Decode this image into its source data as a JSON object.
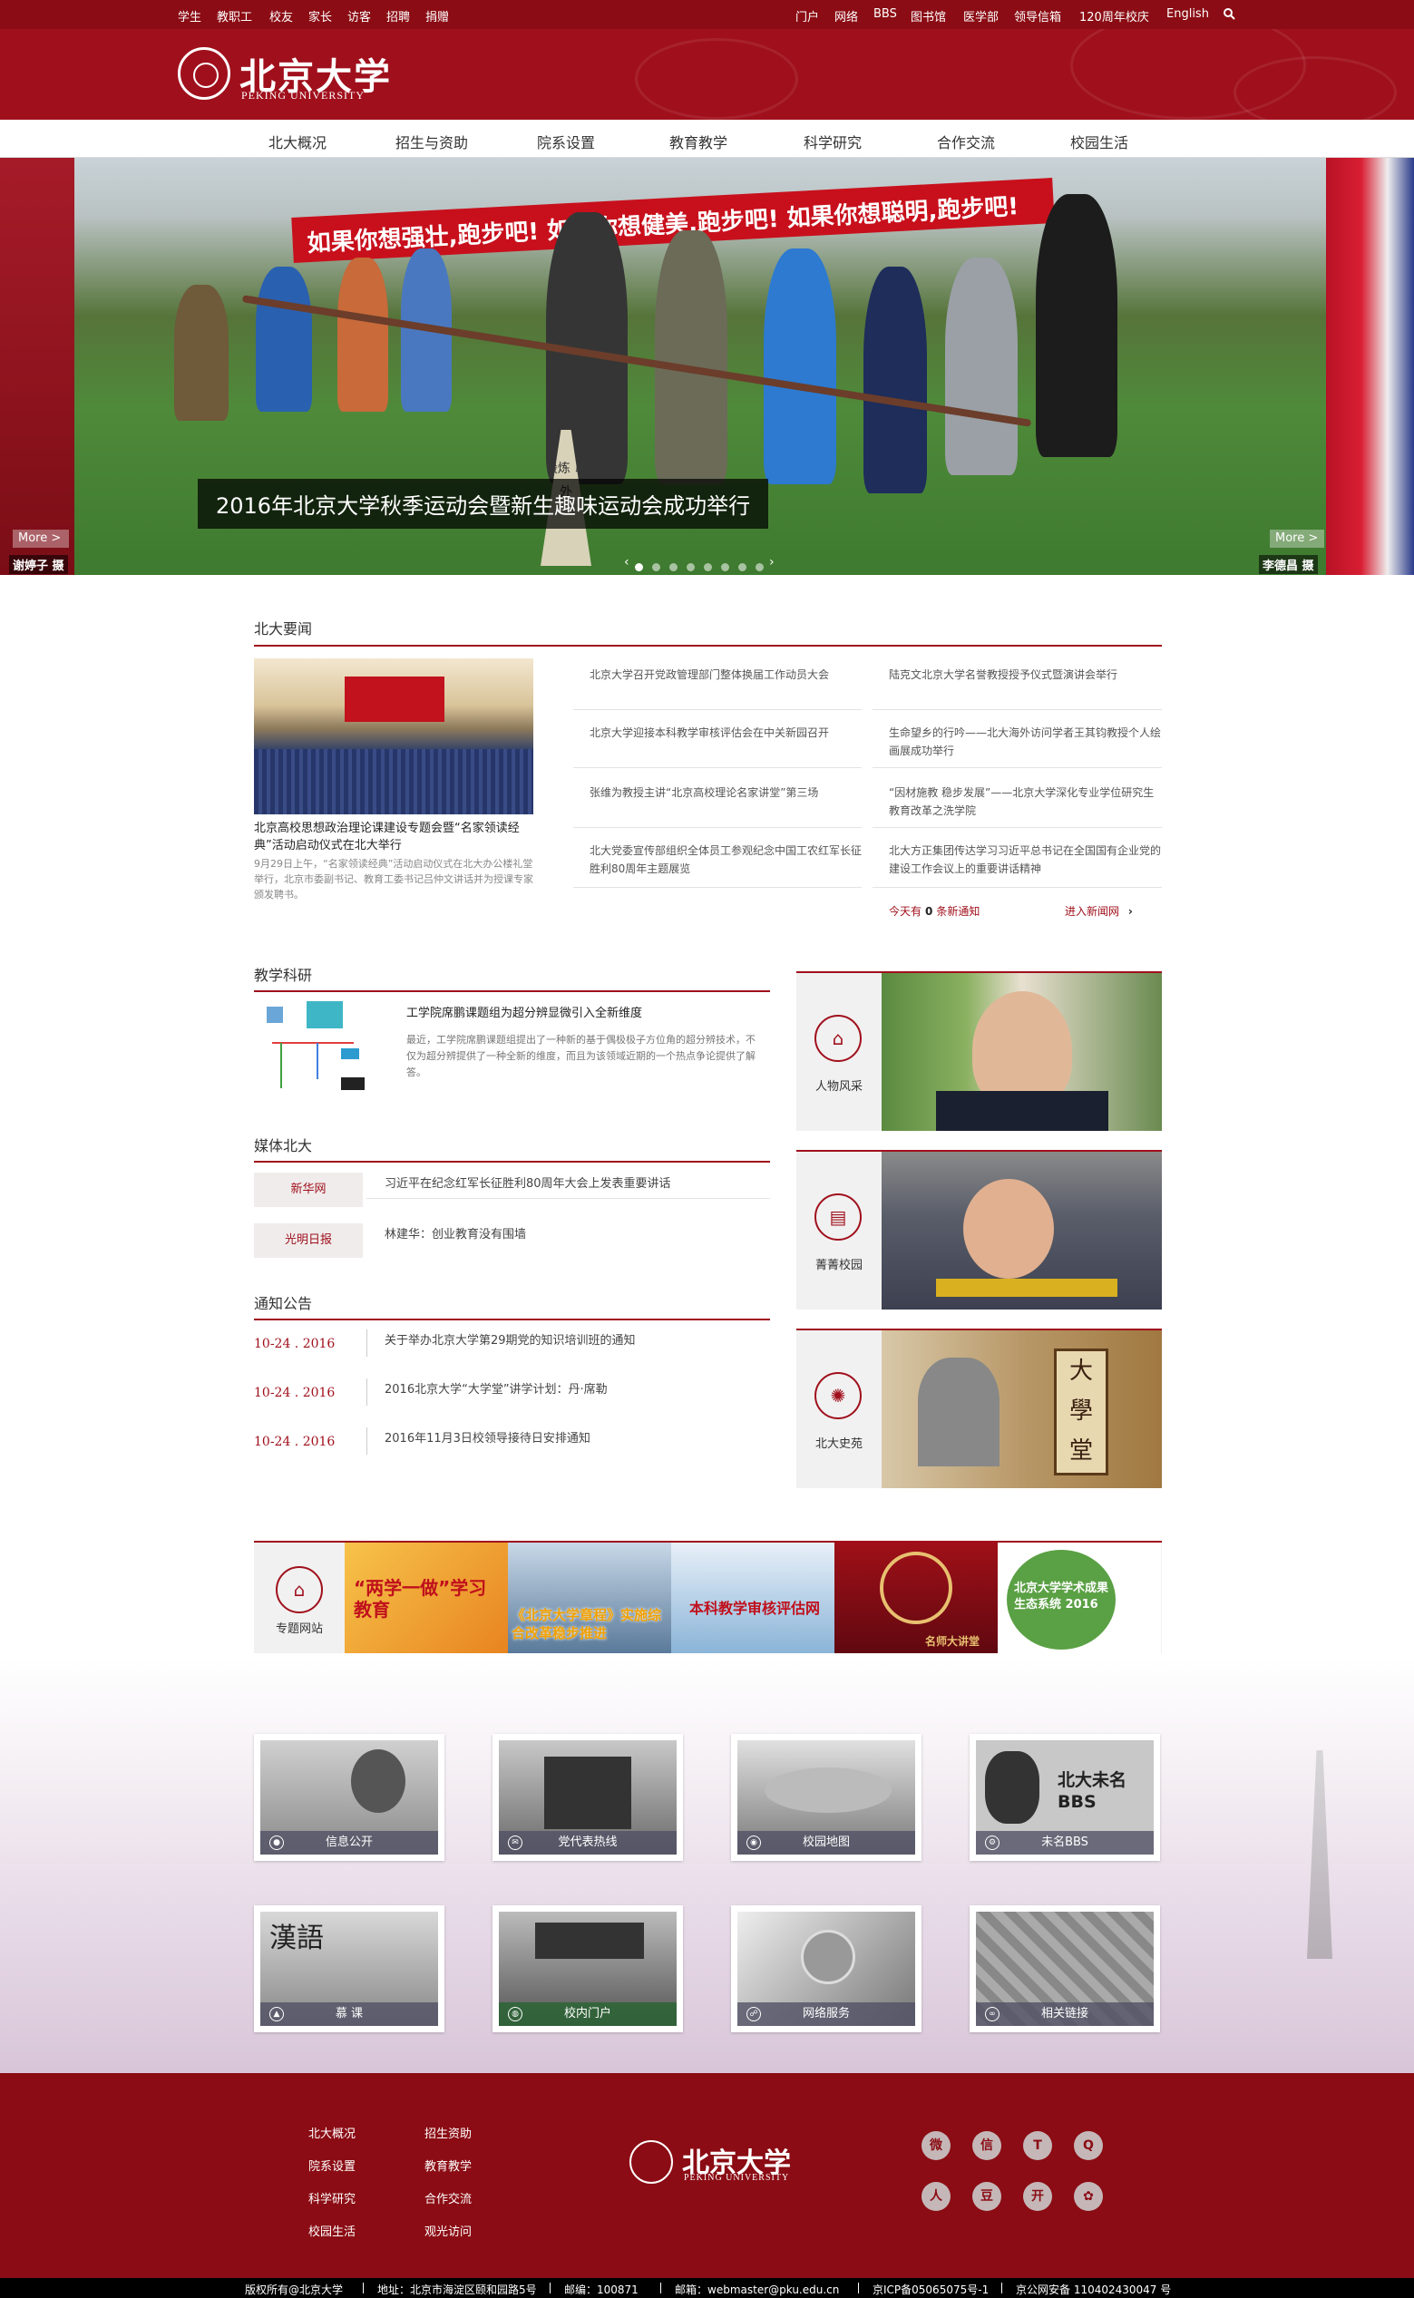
{
  "topbar": {
    "left_links": [
      "学生",
      "教职工",
      "校友",
      "家长",
      "访客",
      "招聘",
      "捐赠"
    ],
    "right_links": [
      "门户",
      "网络",
      "BBS",
      "图书馆",
      "医学部",
      "领导信箱",
      "120周年校庆",
      "English"
    ],
    "search_icon": "search-icon"
  },
  "header": {
    "logo_cn": "北京大学",
    "logo_en": "PEKING UNIVERSITY"
  },
  "nav": {
    "items": [
      "北大概况",
      "招生与资助",
      "院系设置",
      "教育教学",
      "科学研究",
      "合作交流",
      "校园生活"
    ]
  },
  "hero": {
    "banner_text": "如果你想强壮,跑步吧! 如果你想健美,跑步吧! 如果你想聪明,跑步吧!",
    "cone_text": "锻炼 以外",
    "caption": "2016年北京大学秋季运动会暨新生趣味运动会成功举行",
    "more_left": "More >",
    "more_right": "More >",
    "credit_left": "谢婷子 摄",
    "credit_right": "李德昌 摄",
    "dots_total": 8,
    "active_dot": 1
  },
  "news": {
    "title": "北大要闻",
    "lead_title": "北京高校思想政治理论课建设专题会暨“名家领读经典”活动启动仪式在北大举行",
    "lead_desc": "9月29日上午，“名家领读经典”活动启动仪式在北大办公楼礼堂举行，北京市委副书记、教育工委书记吕仲文讲话并为授课专家颁发聘书。",
    "left_items": [
      "北京大学召开党政管理部门整体换届工作动员大会",
      "北京大学迎接本科教学审核评估会在中关新园召开",
      "张维为教授主讲“北京高校理论名家讲堂”第三场",
      "北大党委宣传部组织全体员工参观纪念中国工农红军长征胜利80周年主题展览"
    ],
    "right_items": [
      "陆克文北京大学名誉教授授予仪式暨演讲会举行",
      "生命望乡的行吟——北大海外访问学者王其钧教授个人绘画展成功举行",
      "“因材施教 稳步发展”——北京大学深化专业学位研究生教育改革之洗学院",
      "北大方正集团传达学习习近平总书记在全国国有企业党的建设工作会议上的重要讲话精神"
    ],
    "today_prefix": "今天有",
    "today_count": "0",
    "today_suffix": "条新通知",
    "enter_link": "进入新闻网"
  },
  "teaching": {
    "title": "教学科研",
    "item_title": "工学院席鹏课题组为超分辨显微引入全新维度",
    "item_desc": "最近，工学院席鹏课题组提出了一种新的基于偶极极子方位角的超分辨技术，不仅为超分辨提供了一种全新的维度，而且为该领域近期的一个热点争论提供了解答。"
  },
  "media": {
    "title": "媒体北大",
    "items": [
      {
        "source": "新华网",
        "text": "习近平在纪念红军长征胜利80周年大会上发表重要讲话"
      },
      {
        "source": "光明日报",
        "text": "林建华：创业教育没有围墙"
      }
    ]
  },
  "notices": {
    "title": "通知公告",
    "items": [
      {
        "date": "10-24 . 2016",
        "text": "关于举办北京大学第29期党的知识培训班的通知"
      },
      {
        "date": "10-24 . 2016",
        "text": "2016北京大学“大学堂”讲学计划：丹·席勒"
      },
      {
        "date": "10-24 . 2016",
        "text": "2016年11月3日校领导接待日安排通知"
      }
    ]
  },
  "features": [
    {
      "label": "人物风采",
      "icon": "sofa-icon"
    },
    {
      "label": "菁菁校园",
      "icon": "book-icon"
    },
    {
      "label": "北大史苑",
      "icon": "pku-seal-icon"
    }
  ],
  "projects": {
    "label": "专题网站",
    "icon": "home-icon",
    "tiles": [
      "“两学一做”学习教育",
      "《北京大学章程》实施综合改革稳步推进",
      "本科教学审核评估网",
      "名师大讲堂",
      "北京大学学术成果生态系统 2016"
    ]
  },
  "tiles": [
    {
      "label": "信息公开",
      "icon": "person-icon"
    },
    {
      "label": "党代表热线",
      "icon": "mail-icon"
    },
    {
      "label": "校园地图",
      "icon": "map-pin-icon"
    },
    {
      "label": "未名BBS",
      "icon": "bbs-icon",
      "overlay": "北大未名 BBS"
    },
    {
      "label": "慕 课",
      "icon": "bell-icon",
      "overlay": "漢語"
    },
    {
      "label": "校内门户",
      "icon": "globe-icon"
    },
    {
      "label": "网络服务",
      "icon": "network-icon"
    },
    {
      "label": "相关链接",
      "icon": "link-icon"
    }
  ],
  "footer": {
    "links_col1": [
      "北大概况",
      "院系设置",
      "科学研究",
      "校园生活"
    ],
    "links_col2": [
      "招生资助",
      "教育教学",
      "合作交流",
      "观光访问"
    ],
    "logo_cn": "北京大学",
    "logo_en": "PEKING UNIVERSITY",
    "social_icons": [
      "weibo-icon",
      "wechat-icon",
      "tencent-weibo-icon",
      "qq-icon",
      "renren-icon",
      "douban-icon",
      "kaixin-icon",
      "flower-icon"
    ],
    "social_glyphs": [
      "微",
      "信",
      "T",
      "Q",
      "人",
      "豆",
      "开",
      "✿"
    ]
  },
  "bottombar": {
    "items": [
      "版权所有@北京大学",
      "地址：北京市海淀区颐和园路5号",
      "邮编：100871",
      "邮箱：webmaster@pku.edu.cn",
      "京ICP备05065075号-1",
      "京公网安备 110402430047 号"
    ]
  },
  "colors": {
    "brand_red": "#a0101c",
    "topbar_red": "#8b0c14"
  }
}
